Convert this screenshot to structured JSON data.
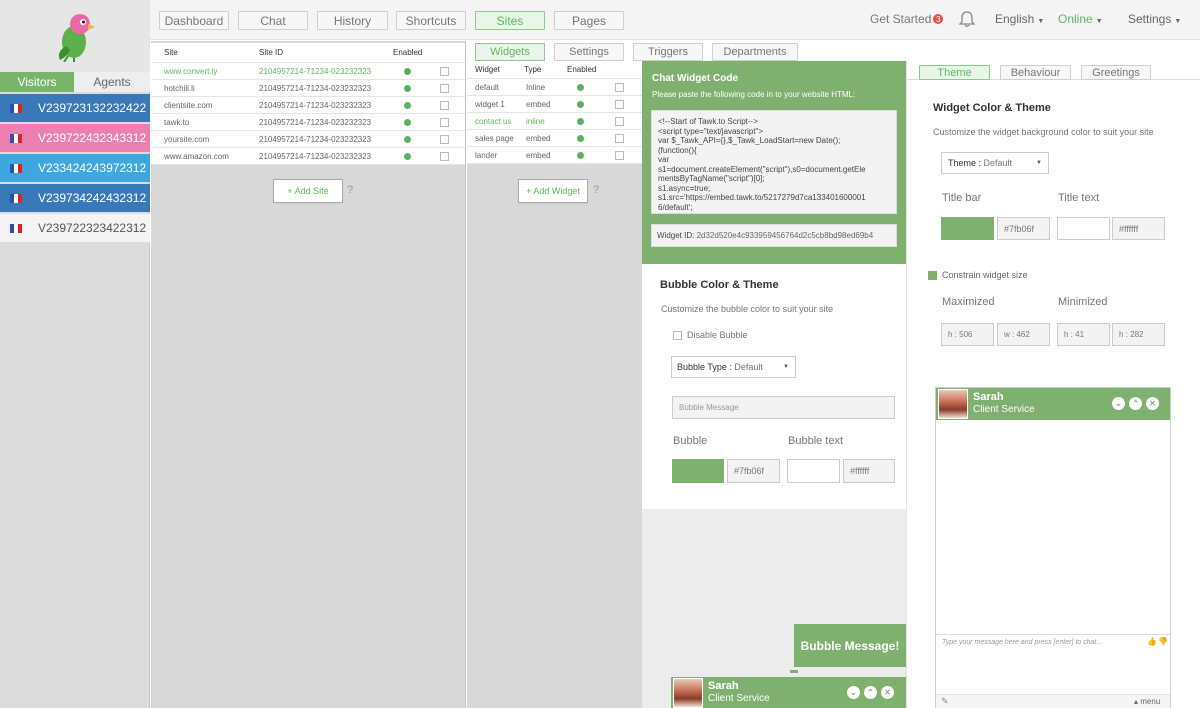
{
  "nav": {
    "tabs": [
      "Dashboard",
      "Chat",
      "History",
      "Shortcuts",
      "Sites",
      "Pages"
    ],
    "get_started": "Get Started",
    "get_started_count": "3",
    "language": "English",
    "status": "Online",
    "settings": "Settings"
  },
  "sidebar": {
    "tab_visitors": "Visitors",
    "tab_agents": "Agents",
    "visitors": [
      {
        "id": "V239723132232422",
        "color": "#3a79b8"
      },
      {
        "id": "V239722432343312",
        "color": "#ea7fb0"
      },
      {
        "id": "V233424243972312",
        "color": "#3fa7df"
      },
      {
        "id": "V239734242432312",
        "color": "#3a79b8"
      },
      {
        "id": "V239722323422312",
        "color": "#f4f4f4"
      }
    ]
  },
  "sites": {
    "headers": {
      "site": "Site",
      "site_id": "Site ID",
      "enabled": "Enabled"
    },
    "rows": [
      {
        "site": "www.convert.ly",
        "id": "2104957214-71234-023232323",
        "highlight": true
      },
      {
        "site": "hotchili.li",
        "id": "2104957214-71234-023232323",
        "highlight": false
      },
      {
        "site": "clientsite.com",
        "id": "2104957214-71234-023232323",
        "highlight": false
      },
      {
        "site": "tawk.to",
        "id": "2104957214-71234-023232323",
        "highlight": false
      },
      {
        "site": "yoursite.com",
        "id": "2104957214-71234-023232323",
        "highlight": false
      },
      {
        "site": "www.amazon.com",
        "id": "2104957214-71234-023232323",
        "highlight": false
      }
    ],
    "add_label": "+ Add Site",
    "help": "?"
  },
  "subtabs": [
    "Widgets",
    "Settings",
    "Triggers",
    "Departments"
  ],
  "widgets": {
    "headers": {
      "widget": "Widget",
      "type": "Type",
      "enabled": "Enabled"
    },
    "rows": [
      {
        "name": "default",
        "type": "Inline",
        "highlight": false
      },
      {
        "name": "widget 1",
        "type": "embed",
        "highlight": false
      },
      {
        "name": "contact us",
        "type": "inline",
        "highlight": true
      },
      {
        "name": "sales page",
        "type": "embed",
        "highlight": false
      },
      {
        "name": "lander",
        "type": "embed",
        "highlight": false
      }
    ],
    "add_label": "+ Add Widget",
    "help": "?"
  },
  "code_panel": {
    "title": "Chat Widget Code",
    "instructions": "Please paste the following code in to your website HTML:",
    "code_lines": [
      "<!--Start of Tawk.to Script-->",
      "<script type=\"text/javascript\">",
      "var $_Tawk_API={},$_Tawk_LoadStart=new Date();",
      "(function(){",
      "var",
      "s1=document.createElement(\"script\"),s0=document.getEle",
      "mentsByTagName(\"script\")[0];",
      "s1.async=true;",
      "s1.src='https://embed.tawk.to/5217279d7ca133401600001",
      "6/default';"
    ],
    "widget_id_label": "Widget ID:",
    "widget_id": "2d32d520e4c933959456764d2c5cb8bd98ed69b4"
  },
  "bubble": {
    "title": "Bubble Color & Theme",
    "subtitle": "Customize the bubble color to suit your site",
    "disable_label": "Disable Bubble",
    "type_label": "Bubble Type :",
    "type_value": "Default",
    "message_placeholder": "Bubble Message",
    "bubble_label": "Bubble",
    "bubble_text_label": "Bubble text",
    "bubble_color": "#7fb06f",
    "bubble_text_color": "#ffffff",
    "preview_message": "Bubble Message!"
  },
  "theme_tabs": [
    "Theme",
    "Behaviour",
    "Greetings"
  ],
  "theme": {
    "title": "Widget Color & Theme",
    "subtitle": "Customize the widget background color to suit your site",
    "theme_label": "Theme :",
    "theme_value": "Default",
    "title_bar_label": "Title bar",
    "title_text_label": "Title text",
    "title_bar_color": "#7fb06f",
    "title_text_color": "#ffffff",
    "constrain_label": "Constrain widget size",
    "maximized_label": "Maximized",
    "minimized_label": "Minimized",
    "max_h": "h : 506",
    "max_w": "w : 462",
    "min_h": "h : 41",
    "min_w": "h : 282"
  },
  "chat_preview": {
    "agent_name": "Sarah",
    "agent_role": "Client Service",
    "input_placeholder": "Type your message here and press [enter] to chat...",
    "menu_label": "menu"
  },
  "icons": [
    "parrot-logo",
    "bell-icon",
    "chevron-down-icon",
    "flag-icon",
    "minimize-icon",
    "maximize-icon",
    "close-icon",
    "thumb-up-icon",
    "thumb-down-icon",
    "attach-icon"
  ]
}
